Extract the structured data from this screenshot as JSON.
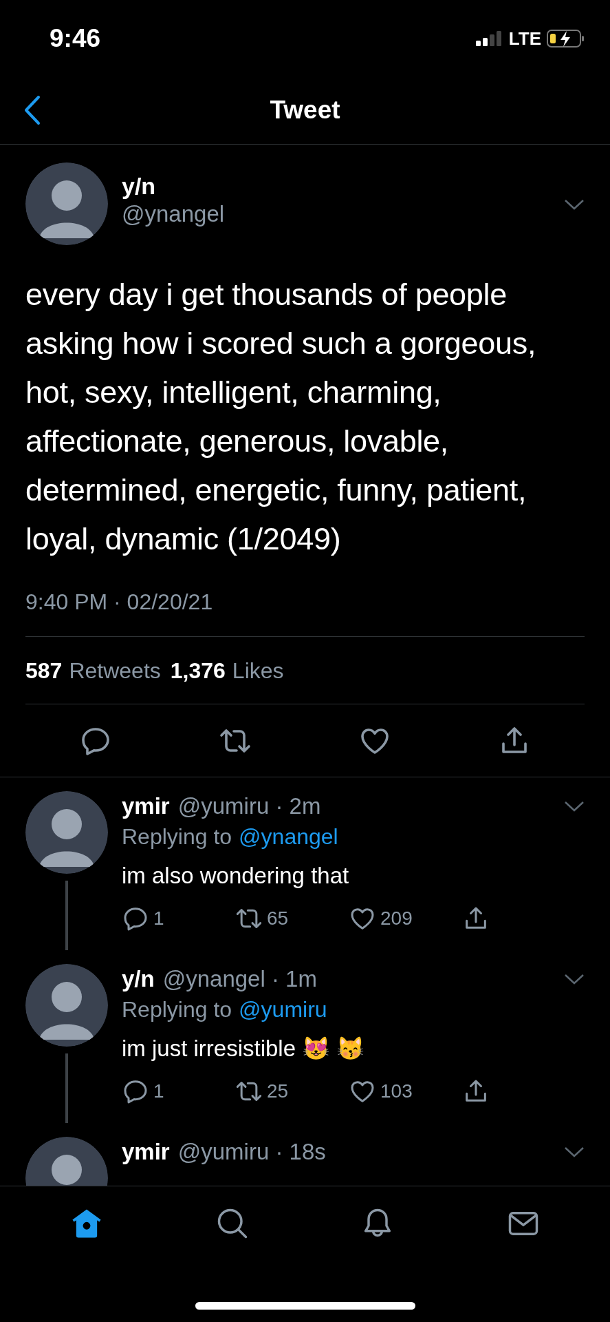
{
  "status_bar": {
    "time": "9:46",
    "network": "LTE"
  },
  "nav": {
    "title": "Tweet"
  },
  "tweet": {
    "name": "y/n",
    "handle": "@ynangel",
    "text": "every day i get thousands of people asking how i scored such a gorgeous, hot, sexy, intelligent, charming, affectionate, generous, lovable, determined, energetic, funny, patient, loyal, dynamic (1/2049)",
    "timestamp": "9:40 PM · 02/20/21",
    "stats": [
      {
        "count": "587",
        "label": "Retweets"
      },
      {
        "count": "1,376",
        "label": "Likes"
      }
    ]
  },
  "replies": [
    {
      "name": "ymir",
      "handle_time": "@yumiru · 2m",
      "replying_label": "Replying to",
      "replying_to": "@ynangel",
      "text": "im also wondering that",
      "comments": "1",
      "retweets": "65",
      "likes": "209",
      "thread_line": true
    },
    {
      "name": "y/n",
      "handle_time": "@ynangel · 1m",
      "replying_label": "Replying to",
      "replying_to": "@yumiru",
      "text": "im just irresistible 😻 😽",
      "comments": "1",
      "retweets": "25",
      "likes": "103",
      "thread_line": true
    },
    {
      "name": "ymir",
      "handle_time": "@yumiru · 18s",
      "thread_line": false
    }
  ],
  "tab_bar": [
    {
      "kind": "home",
      "selected": true
    },
    {
      "kind": "search",
      "selected": false
    },
    {
      "kind": "notifications",
      "selected": false
    },
    {
      "kind": "messages",
      "selected": false
    }
  ]
}
